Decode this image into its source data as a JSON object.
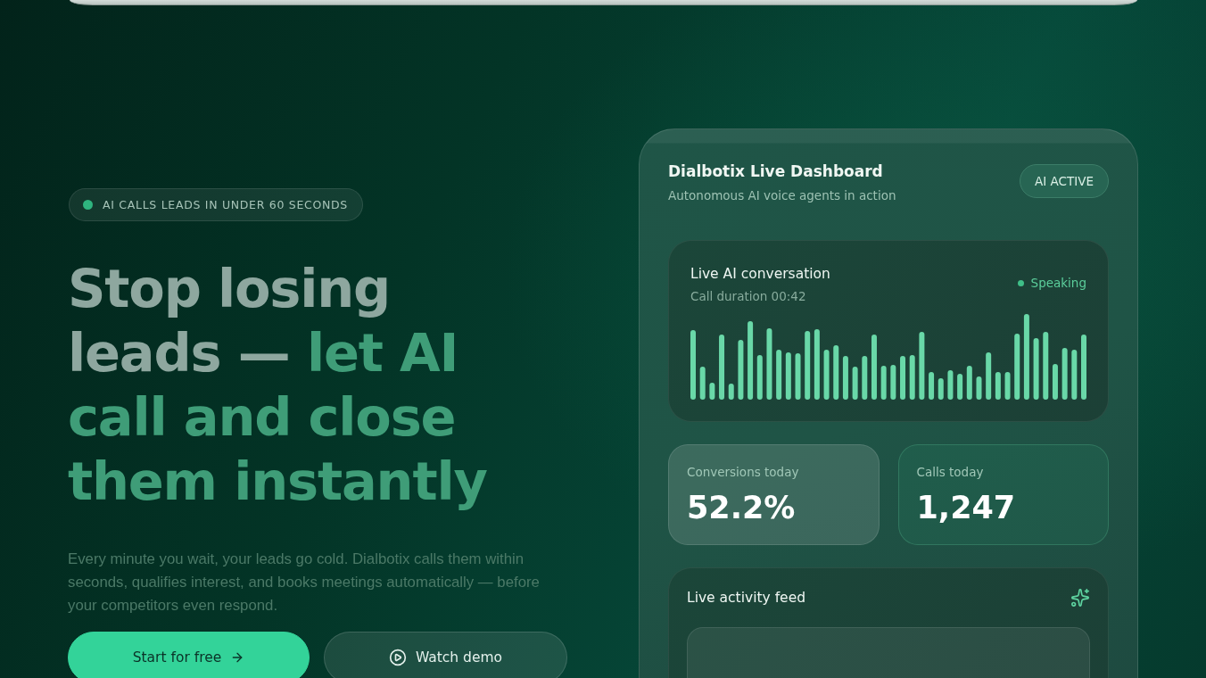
{
  "badge": {
    "label": "AI CALLS LEADS IN UNDER 60 SECONDS"
  },
  "heading": {
    "lead": "Stop losing leads —",
    "highlight": "let AI call and close them instantly"
  },
  "description": "Every minute you wait, your leads go cold. Dialbotix calls them within seconds, qualifies interest, and books meetings automatically — before your competitors even respond.",
  "buttons": [
    {
      "kind": "primary",
      "label": "Start for free"
    },
    {
      "kind": "secondary",
      "label": "Watch demo"
    }
  ],
  "dashboard": {
    "title": "Dialbotix Live Dashboard",
    "subtitle": "Autonomous AI voice agents in action",
    "status": "AI ACTIVE",
    "conversation": {
      "title": "Live AI conversation",
      "duration": "Call duration 00:42",
      "state": "Speaking"
    },
    "stats": [
      {
        "label": "Conversions today",
        "value": "52.2%",
        "highlighted": true
      },
      {
        "label": "Calls today",
        "value": "1,247",
        "highlighted": false
      }
    ],
    "activity_feed": {
      "title": "Live activity feed"
    }
  }
}
